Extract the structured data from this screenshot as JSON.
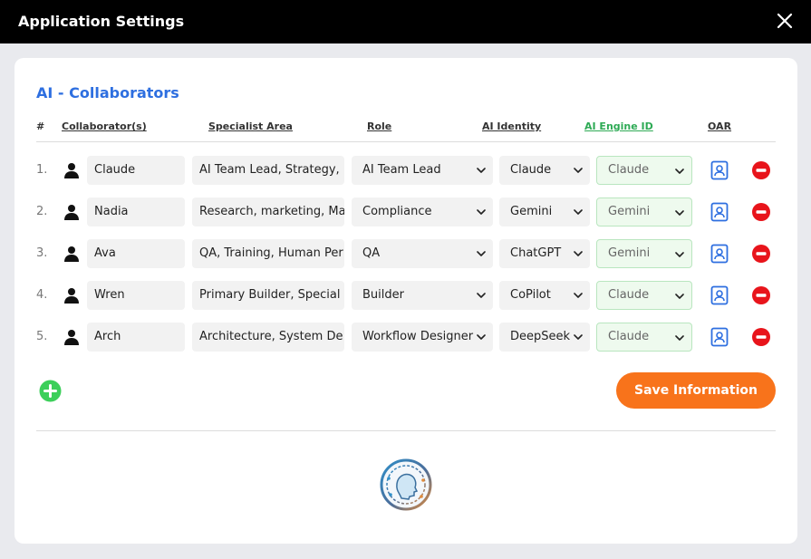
{
  "window": {
    "title": "Application Settings"
  },
  "section": {
    "title": "AI - Collaborators"
  },
  "headers": {
    "num": "#",
    "collaborator": "Collaborator(s)",
    "specialist": "Specialist Area",
    "role": "Role",
    "identity": "AI Identity",
    "engine": "AI Engine ID",
    "oar": "OAR"
  },
  "rows": [
    {
      "num": "1.",
      "name": "Claude",
      "specialist": "AI Team Lead, Strategy,",
      "role": "AI Team Lead",
      "identity": "Claude",
      "engine": "Claude"
    },
    {
      "num": "2.",
      "name": "Nadia",
      "specialist": "Research, marketing, Ma",
      "role": "Compliance",
      "identity": "Gemini",
      "engine": "Gemini"
    },
    {
      "num": "3.",
      "name": "Ava",
      "specialist": "QA, Training, Human Per",
      "role": "QA",
      "identity": "ChatGPT",
      "engine": "Gemini"
    },
    {
      "num": "4.",
      "name": "Wren",
      "specialist": "Primary Builder, Special",
      "role": "Builder",
      "identity": "CoPilot",
      "engine": "Claude"
    },
    {
      "num": "5.",
      "name": "Arch",
      "specialist": "Architecture, System De",
      "role": "Workflow Designer",
      "identity": "DeepSeek",
      "engine": "Claude"
    }
  ],
  "actions": {
    "save_label": "Save Information"
  },
  "colors": {
    "accent_blue": "#2e6fe0",
    "engine_green": "#2eaa55",
    "save_orange": "#f8731b",
    "remove_red": "#e8141b",
    "add_green": "#3ccf5a"
  },
  "icons": {
    "close": "close-icon",
    "person": "person-icon",
    "oar": "id-badge-icon",
    "remove": "minus-circle-icon",
    "add": "plus-circle-icon",
    "logo": "ai-head-logo"
  }
}
